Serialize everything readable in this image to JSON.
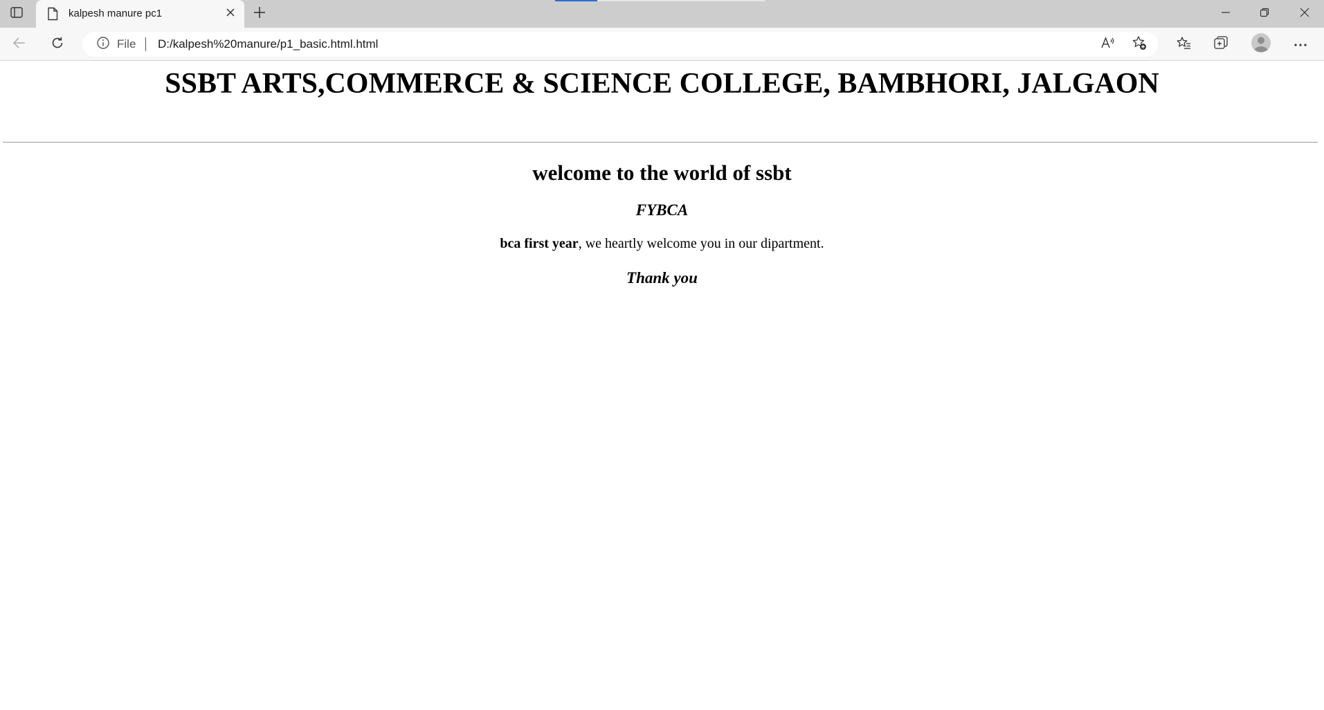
{
  "browser": {
    "tab": {
      "title": "kalpesh manure pc1",
      "favicon": "document-icon"
    },
    "address_bar": {
      "site_info_label": "File",
      "url": "D:/kalpesh%20manure/p1_basic.html.html"
    },
    "icons": {
      "tab_actions": "tab-actions-icon",
      "new_tab": "plus-icon",
      "back": "arrow-left-icon",
      "refresh": "refresh-icon",
      "read_aloud": "read-aloud-icon",
      "add_favorite": "star-plus-icon",
      "favorites": "favorites-icon",
      "collections": "collections-icon",
      "profile": "avatar-icon",
      "more": "ellipsis-icon",
      "minimize": "minimize-icon",
      "restore": "restore-icon",
      "close": "close-icon"
    }
  },
  "page": {
    "heading": "SSBT ARTS,COMMERCE & SCIENCE COLLEGE, BAMBHORI, JALGAON",
    "welcome": "welcome to the world of ssbt",
    "course": "FYBCA",
    "intro_bold": "bca first year",
    "intro_rest": ", we heartly welcome you in our dipartment.",
    "thanks": "Thank you"
  }
}
